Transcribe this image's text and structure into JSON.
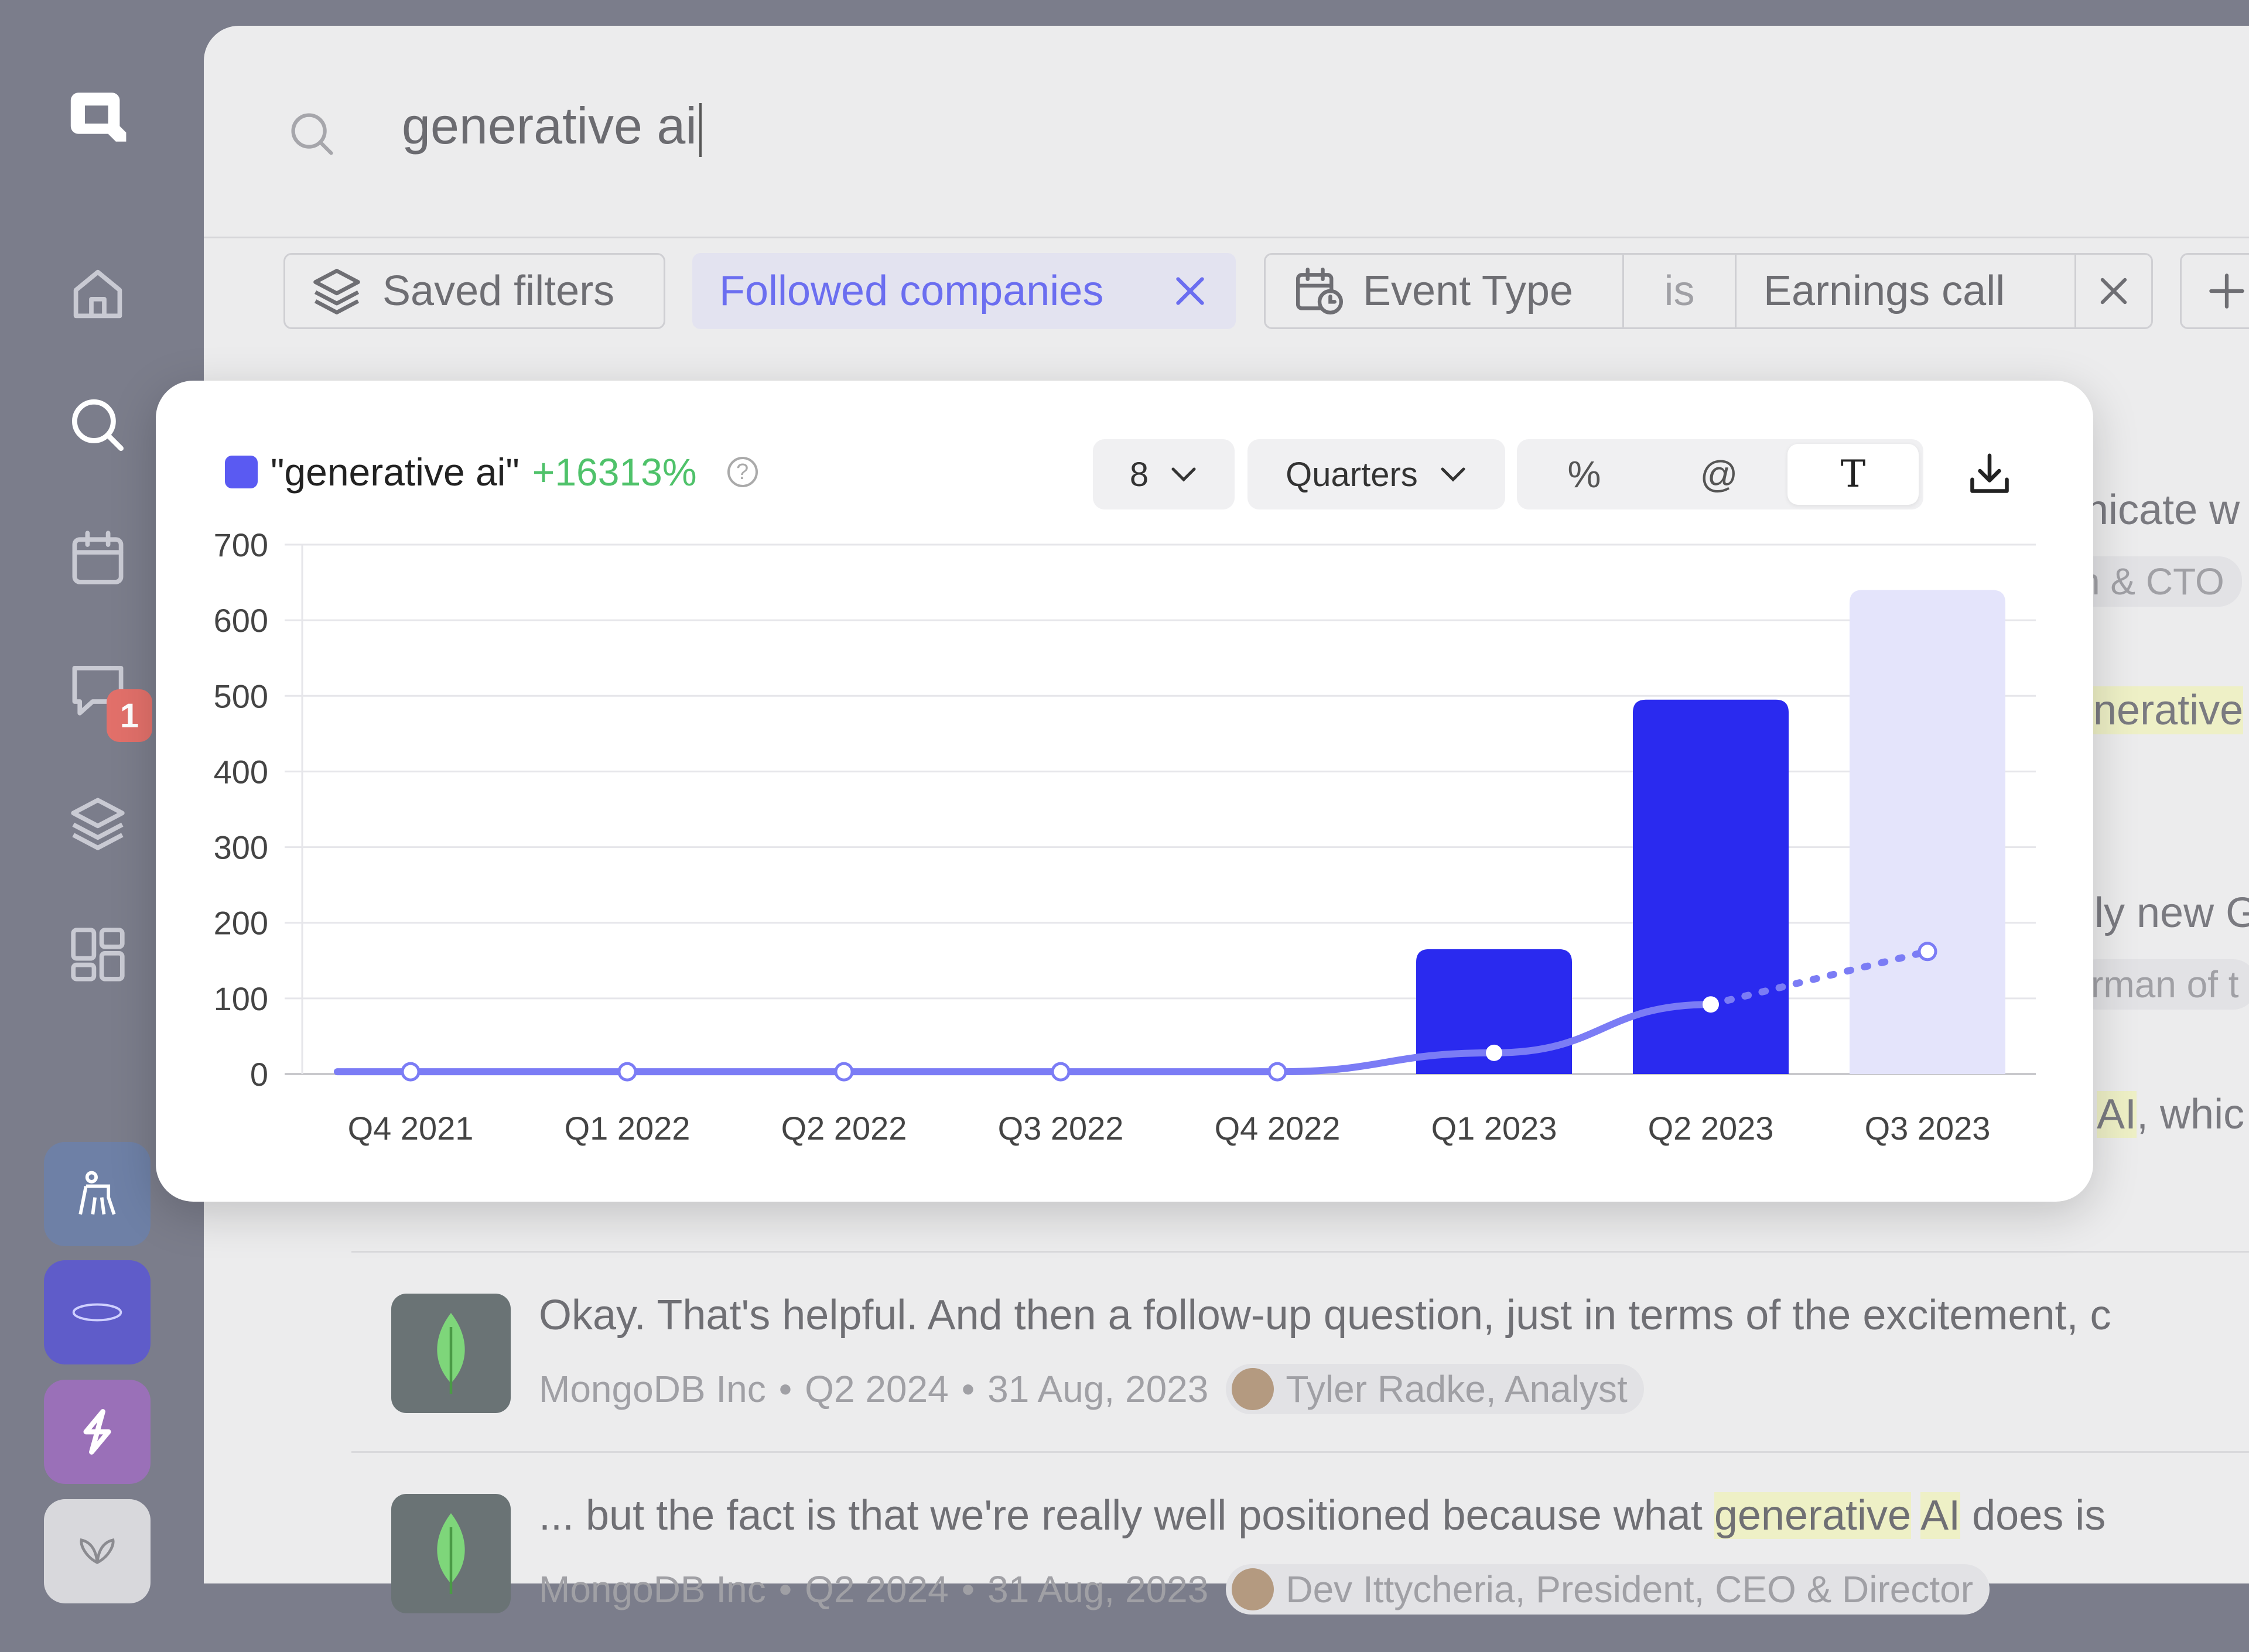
{
  "search": {
    "query": "generative ai"
  },
  "filters": {
    "saved_filters_label": "Saved filters",
    "followed_companies_label": "Followed companies",
    "event_type_label": "Event Type",
    "operator": "is",
    "event_value": "Earnings call"
  },
  "sidebar": {
    "messages_badge": "1"
  },
  "popup": {
    "legend_label": "\"generative ai\"",
    "legend_change": "+16313%",
    "help": "?",
    "periods_count": "8",
    "granularity": "Quarters",
    "toggle_percent": "%",
    "toggle_at": "@",
    "toggle_text": "T",
    "colors": {
      "bar": "#2a2aef",
      "bar_partial": "#e4e4fb",
      "line": "#7b7cf5",
      "swatch": "#5a5af2",
      "change": "#4fc26a"
    }
  },
  "chart_data": {
    "type": "bar",
    "categories": [
      "Q4 2021",
      "Q1 2022",
      "Q2 2022",
      "Q3 2022",
      "Q4 2022",
      "Q1 2023",
      "Q2 2023",
      "Q3 2023"
    ],
    "series": [
      {
        "name": "\"generative ai\"",
        "values": [
          0,
          0,
          0,
          0,
          0,
          165,
          495,
          640
        ],
        "partial_last": true
      }
    ],
    "trend_line": [
      3,
      3,
      3,
      3,
      3,
      28,
      92,
      162
    ],
    "trend_projected_from": "Q2 2023",
    "yticks": [
      0,
      100,
      200,
      300,
      400,
      500,
      600,
      700
    ],
    "ylim": [
      0,
      700
    ],
    "grid": true,
    "legend": "top-left"
  },
  "results": [
    {
      "quote": "Okay. That's helpful. And then a follow-up question, just in terms of the excitement, c",
      "company": "MongoDB Inc",
      "period": "Q2 2024",
      "date": "31 Aug, 2023",
      "speaker": "Tyler Radke, Analyst"
    },
    {
      "quote_pre": "... but the fact is that we're really well positioned because what ",
      "quote_hl1": "generative",
      "quote_hl2": "AI",
      "quote_post": " does is",
      "company": "MongoDB Inc",
      "period": "Q2 2024",
      "date": "31 Aug, 2023",
      "speaker": "Dev Ittycheria, President, CEO & Director"
    }
  ],
  "peeks": {
    "p1": "nicate w",
    "p2": "n & CTO",
    "p3": "nerative",
    "p4": "lly new G",
    "p5": "rman of t",
    "p6_hl": "AI",
    "p6": ", whic"
  },
  "separator": "•"
}
